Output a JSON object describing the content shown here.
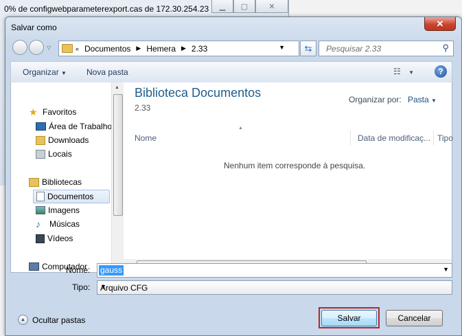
{
  "background_window": {
    "title": "0% de configwebparameterexport.cas de 172.30.254.23 ...",
    "controls": [
      "minimize",
      "maximize",
      "close"
    ]
  },
  "dialog": {
    "title": "Salvar como",
    "close_glyph": "✕"
  },
  "address": {
    "crumbs": [
      "Documentos",
      "Hemera",
      "2.33"
    ]
  },
  "search": {
    "placeholder": "Pesquisar 2.33"
  },
  "toolbar": {
    "organize_label": "Organizar",
    "new_folder_label": "Nova pasta"
  },
  "nav": {
    "items": [
      {
        "label": "Favoritos",
        "icon": "star-icon"
      },
      {
        "label": "Área de Trabalho",
        "icon": "desktop-icon"
      },
      {
        "label": "Downloads",
        "icon": "downloads-folder-icon"
      },
      {
        "label": "Locais",
        "icon": "places-icon"
      },
      {
        "label": "Bibliotecas",
        "icon": "libraries-icon"
      },
      {
        "label": "Documentos",
        "icon": "documents-icon",
        "selected": true
      },
      {
        "label": "Imagens",
        "icon": "pictures-icon"
      },
      {
        "label": "Músicas",
        "icon": "music-icon"
      },
      {
        "label": "Vídeos",
        "icon": "videos-icon"
      },
      {
        "label": "Computador",
        "icon": "computer-icon"
      }
    ]
  },
  "main": {
    "library_title": "Biblioteca Documentos",
    "library_subtitle": "2.33",
    "arrange_label": "Organizar por:",
    "arrange_value": "Pasta",
    "columns": [
      "Nome",
      "Data de modificaç...",
      "Tipo"
    ],
    "empty_message": "Nenhum item corresponde à pesquisa."
  },
  "form": {
    "name_label": "Nome:",
    "name_value": "gauss",
    "type_label": "Tipo:",
    "type_value": "Arquivo CFG"
  },
  "footer": {
    "hide_folders_label": "Ocultar pastas",
    "save_label": "Salvar",
    "cancel_label": "Cancelar"
  },
  "colors": {
    "accent_title": "#1e5d8c",
    "selection": "#3399ff",
    "close_button": "#c9452f",
    "highlight_frame": "#b3282d"
  }
}
